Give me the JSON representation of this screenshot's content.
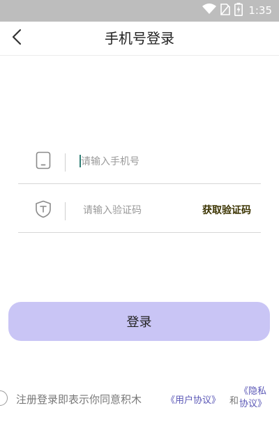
{
  "status_bar": {
    "time": "1:35",
    "icons": [
      "wifi-icon",
      "no-sim-icon",
      "battery-charging-icon"
    ]
  },
  "header": {
    "title": "手机号登录",
    "back_icon": "chevron-left-icon"
  },
  "phone_field": {
    "icon": "phone-icon",
    "placeholder": "请输入手机号",
    "value": ""
  },
  "code_field": {
    "icon": "shield-icon",
    "placeholder": "请输入验证码",
    "value": "",
    "get_code_label": "获取验证码"
  },
  "login_button": {
    "label": "登录"
  },
  "agreement": {
    "text": "注册登录即表示你同意积木",
    "user_agreement": "《用户协议》",
    "and": "和",
    "privacy_agreement": "《隐私协议》"
  },
  "colors": {
    "status_bar": "#bdbdbd",
    "button": "#c9c5f5",
    "link": "#5a57b6",
    "caret": "#2e7d74"
  }
}
